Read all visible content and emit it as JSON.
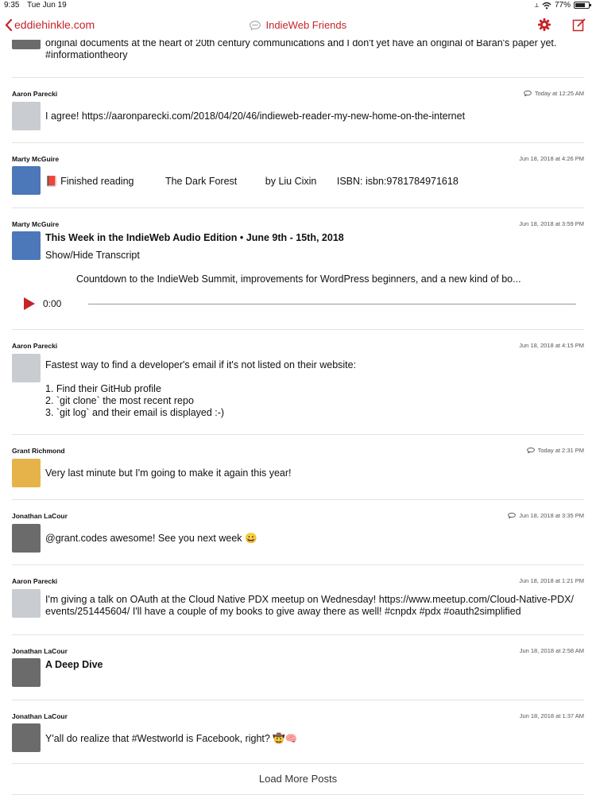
{
  "status": {
    "time": "9:35",
    "date": "Tue Jun 19",
    "battery": "77%",
    "battery_level": 0.77
  },
  "nav": {
    "back_label": "eddiehinkle.com",
    "title": "IndieWeb Friends",
    "accent": "#c5252a"
  },
  "partial_post": {
    "lines": [
      "original documents at the heart of 20th century communications and I don't yet have an original of Baran's paper yet.",
      "#informationtheory"
    ]
  },
  "posts": [
    {
      "author": "Aaron Parecki",
      "time": "Today at 12:25 AM",
      "reply": true,
      "lines": [
        "I agree! https://aaronparecki.com/2018/04/20/46/indieweb-reader-my-new-home-on-the-internet"
      ]
    },
    {
      "author": "Marty McGuire",
      "time": "Jun 18, 2018 at 4:26 PM",
      "reply": false,
      "book": "📕",
      "lines": [
        "Finished reading",
        "The Dark Forest",
        "by Liu Cixin",
        "ISBN: isbn:9781784971618"
      ]
    },
    {
      "author": "Marty McGuire",
      "time": "Jun 18, 2018 at 3:59 PM",
      "reply": false,
      "title": "This Week in the IndieWeb Audio Edition • June 9th - 15th, 2018",
      "lines": [
        "Show/Hide Transcript"
      ],
      "summary": "Countdown to the IndieWeb Summit, improvements for WordPress beginners, and a new kind of bo...",
      "audio_time": "0:00"
    },
    {
      "author": "Aaron Parecki",
      "time": "Jun 18, 2018 at 4:15 PM",
      "reply": false,
      "lines": [
        "Fastest way to find a developer's email if it's not listed on their website:",
        "",
        "1. Find their GitHub profile",
        "2. `git clone` the most recent repo",
        "3. `git log` and their email is displayed :-)"
      ]
    },
    {
      "author": "Grant Richmond",
      "time": "Today at 2:31 PM",
      "reply": true,
      "lines": [
        "Very last minute but I'm going to make it again this year!"
      ]
    },
    {
      "author": "Jonathan LaCour",
      "time": "Jun 18, 2018 at 3:35 PM",
      "reply": true,
      "lines": [
        "@grant.codes awesome! See you next week 😀"
      ]
    },
    {
      "author": "Aaron Parecki",
      "time": "Jun 18, 2018 at 1:21 PM",
      "reply": false,
      "lines": [
        "I'm giving a talk on OAuth at the Cloud Native PDX meetup on Wednesday! https://www.meetup.com/Cloud-Native-PDX/",
        "events/251445604/ I'll have a couple of my books to give away there as well! #cnpdx #pdx #oauth2simplified"
      ]
    },
    {
      "author": "Jonathan LaCour",
      "time": "Jun 18, 2018 at 2:58 AM",
      "reply": false,
      "title": "A Deep Dive",
      "lines": []
    },
    {
      "author": "Jonathan LaCour",
      "time": "Jun 18, 2018 at 1:37 AM",
      "reply": false,
      "lines": [
        "Y'all do realize that #Westworld is Facebook, right? 🤠🧠"
      ]
    }
  ],
  "load_more": "Load More Posts"
}
